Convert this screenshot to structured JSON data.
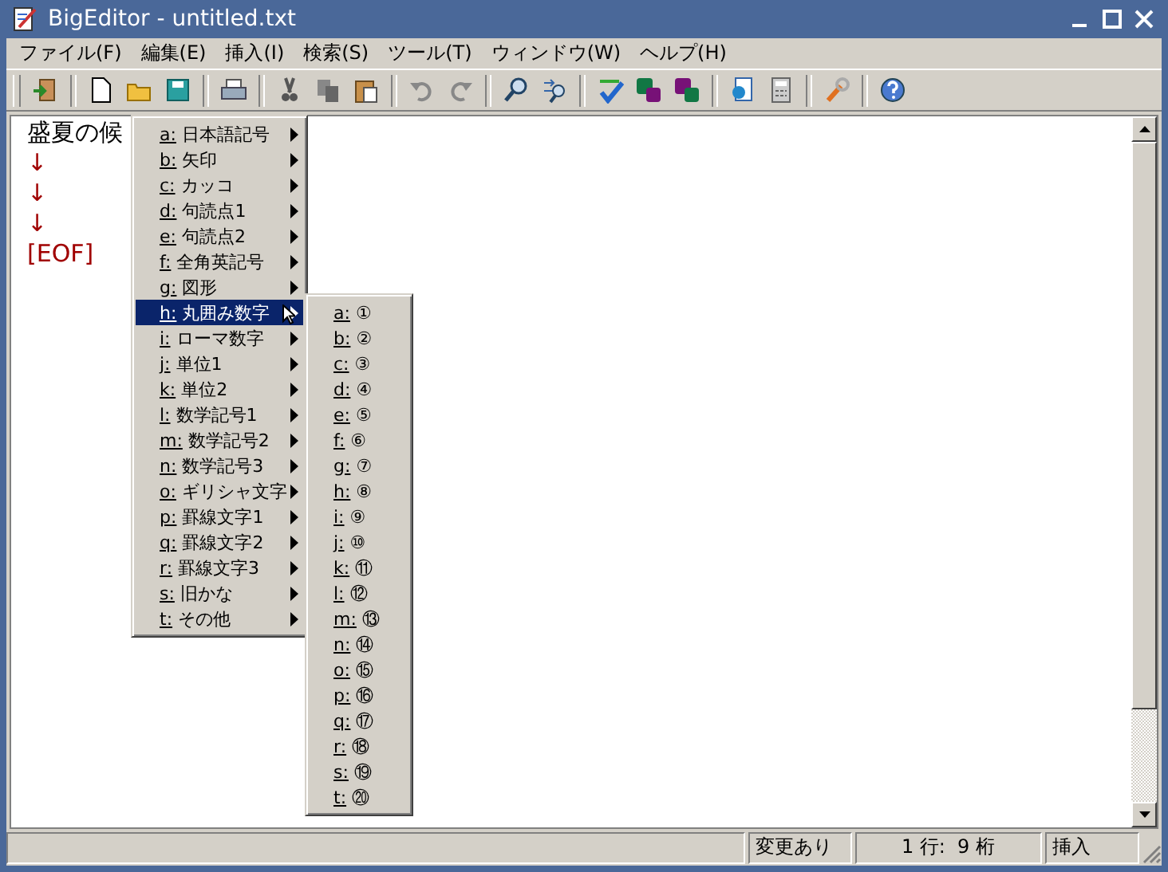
{
  "window": {
    "title": "BigEditor - untitled.txt"
  },
  "menu_bar": [
    {
      "label": "ファイル(F)"
    },
    {
      "label": "編集(E)"
    },
    {
      "label": "挿入(I)"
    },
    {
      "label": "検索(S)"
    },
    {
      "label": "ツール(T)"
    },
    {
      "label": "ウィンドウ(W)"
    },
    {
      "label": "ヘルプ(H)"
    }
  ],
  "editor": {
    "lines": [
      {
        "kind": "text",
        "text": "盛夏の候"
      },
      {
        "kind": "mark",
        "text": "↓"
      },
      {
        "kind": "mark",
        "text": "↓"
      },
      {
        "kind": "mark",
        "text": "↓"
      },
      {
        "kind": "mark",
        "text": "[EOF]"
      }
    ]
  },
  "context_menu": {
    "items": [
      {
        "key": "a:",
        "label": "日本語記号",
        "selected": false
      },
      {
        "key": "b:",
        "label": "矢印",
        "selected": false
      },
      {
        "key": "c:",
        "label": "カッコ",
        "selected": false
      },
      {
        "key": "d:",
        "label": "句読点1",
        "selected": false
      },
      {
        "key": "e:",
        "label": "句読点2",
        "selected": false
      },
      {
        "key": "f:",
        "label": "全角英記号",
        "selected": false
      },
      {
        "key": "g:",
        "label": "図形",
        "selected": false
      },
      {
        "key": "h:",
        "label": "丸囲み数字",
        "selected": true
      },
      {
        "key": "i:",
        "label": "ローマ数字",
        "selected": false
      },
      {
        "key": "j:",
        "label": "単位1",
        "selected": false
      },
      {
        "key": "k:",
        "label": "単位2",
        "selected": false
      },
      {
        "key": "l:",
        "label": "数学記号1",
        "selected": false
      },
      {
        "key": "m:",
        "label": "数学記号2",
        "selected": false
      },
      {
        "key": "n:",
        "label": "数学記号3",
        "selected": false
      },
      {
        "key": "o:",
        "label": "ギリシャ文字",
        "selected": false
      },
      {
        "key": "p:",
        "label": "罫線文字1",
        "selected": false
      },
      {
        "key": "q:",
        "label": "罫線文字2",
        "selected": false
      },
      {
        "key": "r:",
        "label": "罫線文字3",
        "selected": false
      },
      {
        "key": "s:",
        "label": "旧かな",
        "selected": false
      },
      {
        "key": "t:",
        "label": "その他",
        "selected": false
      }
    ]
  },
  "submenu": {
    "items": [
      {
        "key": "a:",
        "label": "①"
      },
      {
        "key": "b:",
        "label": "②"
      },
      {
        "key": "c:",
        "label": "③"
      },
      {
        "key": "d:",
        "label": "④"
      },
      {
        "key": "e:",
        "label": "⑤"
      },
      {
        "key": "f:",
        "label": "⑥"
      },
      {
        "key": "g:",
        "label": "⑦"
      },
      {
        "key": "h:",
        "label": "⑧"
      },
      {
        "key": "i:",
        "label": "⑨"
      },
      {
        "key": "j:",
        "label": "⑩"
      },
      {
        "key": "k:",
        "label": "⑪"
      },
      {
        "key": "l:",
        "label": "⑫"
      },
      {
        "key": "m:",
        "label": "⑬"
      },
      {
        "key": "n:",
        "label": "⑭"
      },
      {
        "key": "o:",
        "label": "⑮"
      },
      {
        "key": "p:",
        "label": "⑯"
      },
      {
        "key": "q:",
        "label": "⑰"
      },
      {
        "key": "r:",
        "label": "⑱"
      },
      {
        "key": "s:",
        "label": "⑲"
      },
      {
        "key": "t:",
        "label": "⑳"
      }
    ]
  },
  "status_bar": {
    "fields": [
      "変更あり",
      "1 行:  9 桁",
      "挿入"
    ]
  }
}
